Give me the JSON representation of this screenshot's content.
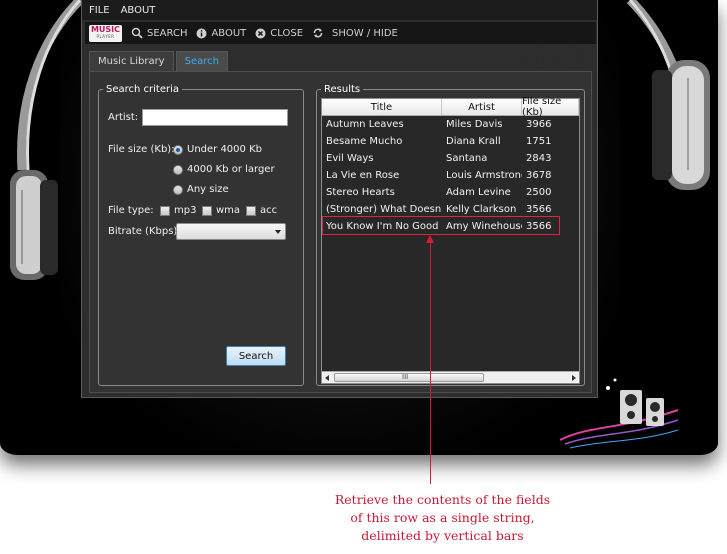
{
  "menu": {
    "file": "FILE",
    "about": "ABOUT"
  },
  "toolbar": {
    "logo_top": "MUSIC",
    "logo_bottom": "PLAYER",
    "search": "SEARCH",
    "about": "ABOUT",
    "close": "CLOSE",
    "show_hide": "SHOW / HIDE"
  },
  "tabs": [
    {
      "label": "Music Library",
      "active": false
    },
    {
      "label": "Search",
      "active": true
    }
  ],
  "criteria": {
    "legend": "Search criteria",
    "artist_label": "Artist:",
    "artist_value": "",
    "file_size_label": "File size (Kb):",
    "file_size_options": [
      {
        "label": "Under 4000 Kb",
        "selected": true
      },
      {
        "label": "4000 Kb or larger",
        "selected": false
      },
      {
        "label": "Any size",
        "selected": false
      }
    ],
    "file_type_label": "File type:",
    "file_types": [
      {
        "label": "mp3",
        "checked": false
      },
      {
        "label": "wma",
        "checked": false
      },
      {
        "label": "acc",
        "checked": false
      }
    ],
    "bitrate_label": "Bitrate (Kbps):",
    "bitrate_value": "",
    "search_button": "Search"
  },
  "results": {
    "legend": "Results",
    "columns": [
      "Title",
      "Artist",
      "File size (Kb)"
    ],
    "rows": [
      {
        "title": "Autumn Leaves",
        "artist": "Miles Davis",
        "size": "3966"
      },
      {
        "title": "Besame Mucho",
        "artist": "Diana Krall",
        "size": "1751"
      },
      {
        "title": "Evil Ways",
        "artist": "Santana",
        "size": "2843"
      },
      {
        "title": "La Vie en Rose",
        "artist": "Louis Armstrong",
        "size": "3678"
      },
      {
        "title": "Stereo Hearts",
        "artist": "Adam Levine",
        "size": "2500"
      },
      {
        "title": "(Stronger) What Doesn't K",
        "artist": "Kelly Clarkson",
        "size": "3566"
      },
      {
        "title": "You Know I'm No Good",
        "artist": "Amy Winehouse",
        "size": "3566"
      }
    ],
    "scroll_grip": "III"
  },
  "annotation": {
    "line1": "Retrieve the contents of the fields",
    "line2": "of this row as a single string,",
    "line3": "delimited by vertical bars"
  },
  "colors": {
    "accent": "#3fa9f5",
    "annotation": "#c41a33",
    "window": "#2d2d2d"
  }
}
